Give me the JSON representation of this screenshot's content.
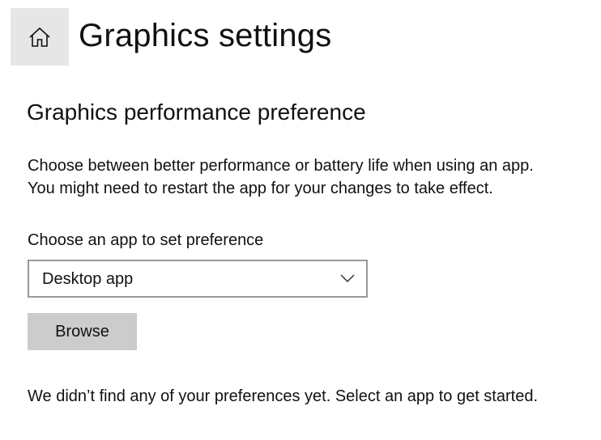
{
  "header": {
    "home_icon": "home-icon",
    "title": "Graphics settings"
  },
  "section": {
    "title": "Graphics performance preference",
    "description_lines": [
      "Choose between better performance or battery life when using an app.",
      "You might need to restart the app for your changes to take effect."
    ]
  },
  "app_picker": {
    "label": "Choose an app to set preference",
    "selected": "Desktop app",
    "chevron_icon": "chevron-down-icon"
  },
  "browse_button": {
    "label": "Browse"
  },
  "empty_message": "We didn’t find any of your preferences yet. Select an app to get started.",
  "colors": {
    "home_button_bg": "#e6e6e6",
    "browse_button_bg": "#cccccc",
    "select_border": "#999999"
  }
}
